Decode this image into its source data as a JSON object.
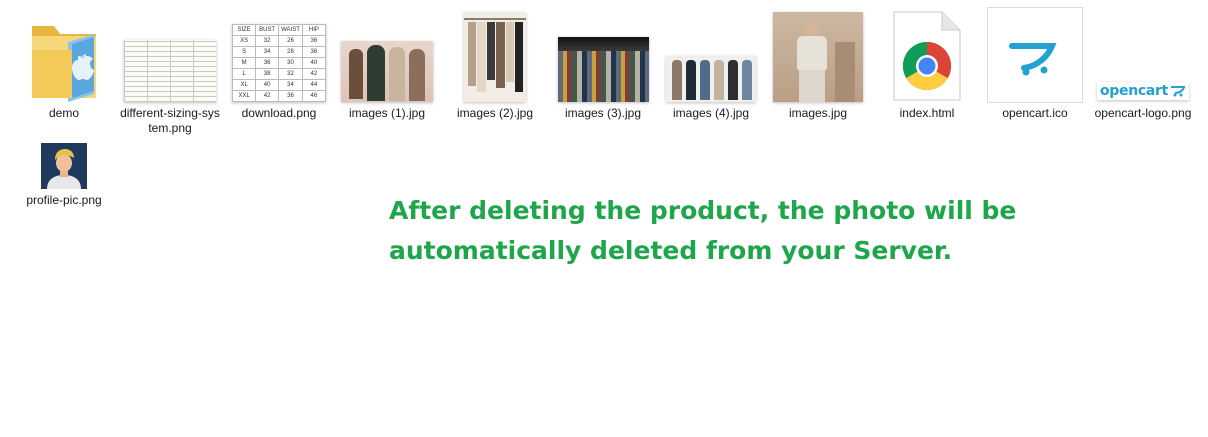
{
  "files": [
    {
      "name": "demo",
      "icon": "folder-icon"
    },
    {
      "name": "different-sizing-system.png",
      "icon": "size-chart-thumbnail"
    },
    {
      "name": "download.png",
      "icon": "size-table-thumbnail"
    },
    {
      "name": "images (1).jpg",
      "icon": "fashion-photo-thumbnail"
    },
    {
      "name": "images (2).jpg",
      "icon": "clothes-rack-photo-thumbnail"
    },
    {
      "name": "images (3).jpg",
      "icon": "clothing-store-photo-thumbnail"
    },
    {
      "name": "images (4).jpg",
      "icon": "models-photo-thumbnail"
    },
    {
      "name": "images.jpg",
      "icon": "model-photo-thumbnail"
    },
    {
      "name": "index.html",
      "icon": "chrome-html-icon"
    },
    {
      "name": "opencart.ico",
      "icon": "opencart-icon"
    },
    {
      "name": "opencart-logo.png",
      "icon": "opencart-logo-thumbnail"
    },
    {
      "name": "profile-pic.png",
      "icon": "profile-avatar-thumbnail"
    }
  ],
  "size_table": {
    "headers": [
      "SIZE",
      "BUST",
      "WAIST",
      "HIP"
    ],
    "rows": [
      [
        "XS",
        "32",
        "26",
        "36"
      ],
      [
        "S",
        "34",
        "28",
        "38"
      ],
      [
        "M",
        "36",
        "30",
        "40"
      ],
      [
        "L",
        "38",
        "32",
        "42"
      ],
      [
        "XL",
        "40",
        "34",
        "44"
      ],
      [
        "XXL",
        "42",
        "36",
        "46"
      ]
    ]
  },
  "opencart_logo_text": "opencart",
  "note": {
    "line1": "After deleting the product, the photo will be",
    "line2": "automatically deleted from your Server."
  },
  "colors": {
    "note_text": "#1ea64a",
    "opencart_blue": "#23a1d1",
    "folder_yellow": "#f3c95a"
  }
}
